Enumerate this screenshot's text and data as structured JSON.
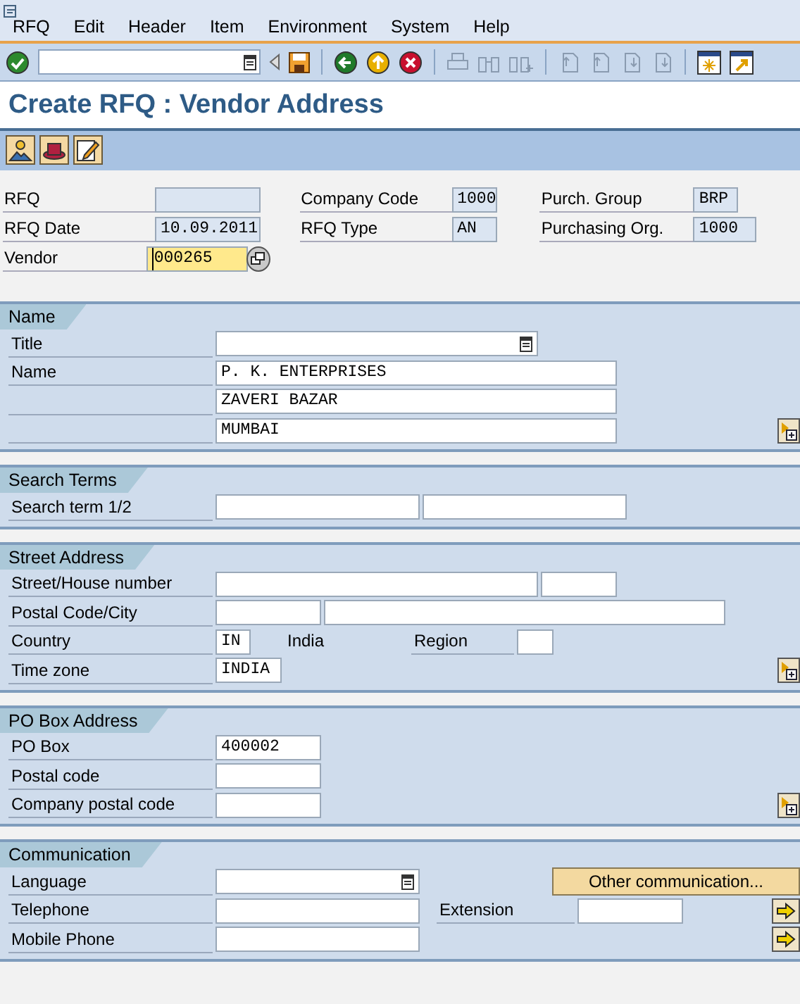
{
  "menu": [
    {
      "label": "RFQ"
    },
    {
      "label": "Edit"
    },
    {
      "label": "Header"
    },
    {
      "label": "Item"
    },
    {
      "label": "Environment"
    },
    {
      "label": "System"
    },
    {
      "label": "Help"
    }
  ],
  "title": "Create RFQ : Vendor Address",
  "header": [
    [
      {
        "label": "RFQ",
        "kind": "readonly"
      },
      {
        "label": "Company Code",
        "value": "1000",
        "kind": "readonly"
      },
      {
        "label": "Purch. Group",
        "value": "BRP",
        "kind": "readonly"
      }
    ],
    [
      {
        "label": "RFQ Date",
        "value": "10.09.2011",
        "kind": "readonly"
      },
      {
        "label": "RFQ Type",
        "value": "AN",
        "kind": "readonly"
      },
      {
        "label": "Purchasing Org.",
        "value": "1000",
        "kind": "readonly"
      }
    ],
    [
      {
        "label": "Vendor",
        "value": "000265",
        "kind": "required",
        "focused": true
      }
    ]
  ],
  "sections": [
    {
      "title": "Name",
      "rows": [
        {
          "label": "Title",
          "parts": [
            {
              "kind": "dropdown"
            }
          ]
        },
        {
          "label": "Name",
          "parts": [
            {
              "kind": "field",
              "value": "P. K. ENTERPRISES"
            }
          ]
        },
        {
          "parts": [
            {
              "kind": "field",
              "value": "ZAVERI BAZAR"
            }
          ]
        },
        {
          "parts": [
            {
              "kind": "field",
              "value": "MUMBAI"
            },
            {
              "kind": "expand"
            }
          ]
        }
      ]
    },
    {
      "title": "Search Terms",
      "rows": [
        {
          "label": "Search term 1/2",
          "parts": [
            {
              "kind": "field"
            },
            {
              "kind": "field"
            }
          ]
        }
      ]
    },
    {
      "title": "Street Address",
      "rows": [
        {
          "label": "Street/House number",
          "parts": [
            {
              "kind": "field"
            },
            {
              "kind": "field"
            }
          ]
        },
        {
          "label": "Postal Code/City",
          "parts": [
            {
              "kind": "field"
            },
            {
              "kind": "field"
            }
          ]
        },
        {
          "label": "Country",
          "parts": [
            {
              "kind": "field",
              "value": "IN"
            },
            {
              "kind": "text",
              "value": "India"
            },
            {
              "kind": "label",
              "value": "Region"
            },
            {
              "kind": "field"
            }
          ]
        },
        {
          "label": "Time zone",
          "parts": [
            {
              "kind": "field",
              "value": "INDIA"
            },
            {
              "kind": "expand"
            }
          ]
        }
      ]
    },
    {
      "title": "PO Box Address",
      "rows": [
        {
          "label": "PO Box",
          "parts": [
            {
              "kind": "field",
              "value": "400002"
            }
          ]
        },
        {
          "label": "Postal code",
          "parts": [
            {
              "kind": "field"
            }
          ]
        },
        {
          "label": "Company postal code",
          "parts": [
            {
              "kind": "field"
            },
            {
              "kind": "expand"
            }
          ]
        }
      ]
    },
    {
      "title": "Communication",
      "rows": [
        {
          "label": "Language",
          "parts": [
            {
              "kind": "dropdown"
            },
            {
              "kind": "button",
              "value": "Other communication..."
            }
          ]
        },
        {
          "label": "Telephone",
          "parts": [
            {
              "kind": "field"
            },
            {
              "kind": "label",
              "value": "Extension"
            },
            {
              "kind": "field"
            },
            {
              "kind": "arrow"
            }
          ]
        },
        {
          "label": "Mobile Phone",
          "parts": [
            {
              "kind": "field"
            },
            {
              "kind": "arrow"
            }
          ]
        }
      ]
    }
  ]
}
